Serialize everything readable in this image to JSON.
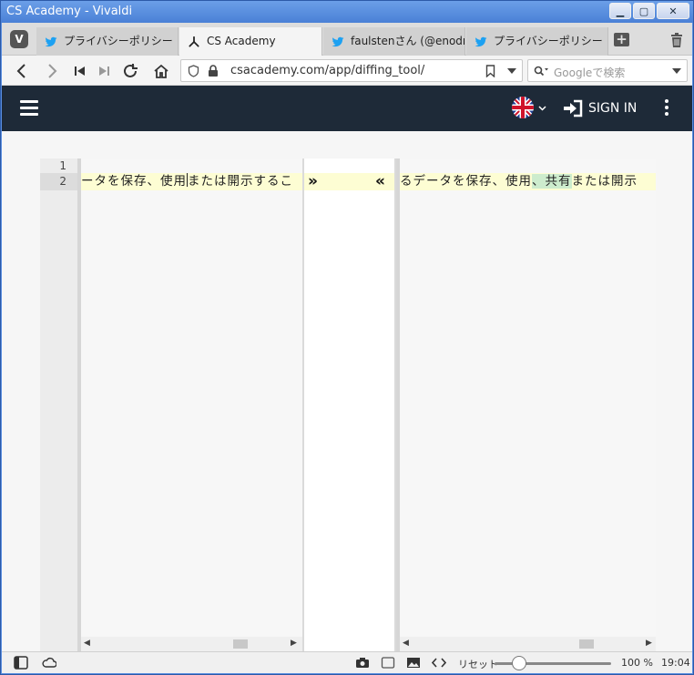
{
  "window": {
    "title": "CS Academy - Vivaldi"
  },
  "tabs": [
    {
      "label": "プライバシーポリシー",
      "icon": "twitter-icon",
      "active": false
    },
    {
      "label": "CS Academy",
      "icon": "csacademy-icon",
      "active": true
    },
    {
      "label": "faulstenさん (@enodrant",
      "icon": "twitter-icon",
      "active": false
    },
    {
      "label": "プライバシーポリシー",
      "icon": "twitter-icon",
      "active": false
    }
  ],
  "address": {
    "url": "csacademy.com/app/diffing_tool/"
  },
  "search": {
    "placeholder": "Googleで検索"
  },
  "header": {
    "signin_label": "SIGN IN",
    "language": "en-gb"
  },
  "editor": {
    "line_numbers": [
      "1",
      "2"
    ],
    "left_line2_before": "ータを保存、使用",
    "left_line2_after": "または開示するこ",
    "right_line2_a": "るデータを保存、使用",
    "right_line2_added": "、共有",
    "right_line2_b": "または開示",
    "merge_right": "»",
    "merge_left": "«"
  },
  "statusbar": {
    "reset_label": "リセット",
    "zoom": "100 %",
    "zoom_level": 0.2,
    "clock": "19:04"
  },
  "colors": {
    "header_bg": "#1e2a38",
    "changed_line": "#fdfdd3",
    "added_text": "#cdeccd",
    "twitter": "#1da1f2"
  }
}
